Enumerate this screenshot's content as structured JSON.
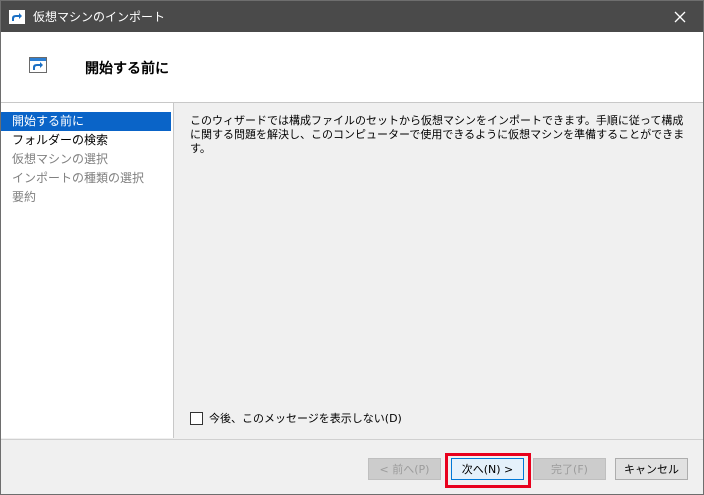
{
  "window": {
    "title": "仮想マシンのインポート"
  },
  "header": {
    "title": "開始する前に"
  },
  "sidebar": {
    "items": [
      {
        "label": "開始する前に",
        "state": "active"
      },
      {
        "label": "フォルダーの検索",
        "state": "enabled"
      },
      {
        "label": "仮想マシンの選択",
        "state": "disabled"
      },
      {
        "label": "インポートの種類の選択",
        "state": "disabled"
      },
      {
        "label": "要約",
        "state": "disabled"
      }
    ]
  },
  "content": {
    "description": "このウィザードでは構成ファイルのセットから仮想マシンをインポートできます。手順に従って構成に関する問題を解決し、このコンピューターで使用できるように仮想マシンを準備することができます。",
    "checkbox_label": "今後、このメッセージを表示しない(D)",
    "checkbox_checked": false
  },
  "footer": {
    "back_label": "< 前へ(P)",
    "next_label": "次へ(N) >",
    "finish_label": "完了(F)",
    "cancel_label": "キャンセル"
  },
  "colors": {
    "titlebar": "#4a4a4a",
    "selection": "#0a64c8",
    "highlight": "#e8001c"
  },
  "icons": {
    "title": "import-vm-icon",
    "header": "import-vm-icon",
    "close": "close-icon"
  }
}
